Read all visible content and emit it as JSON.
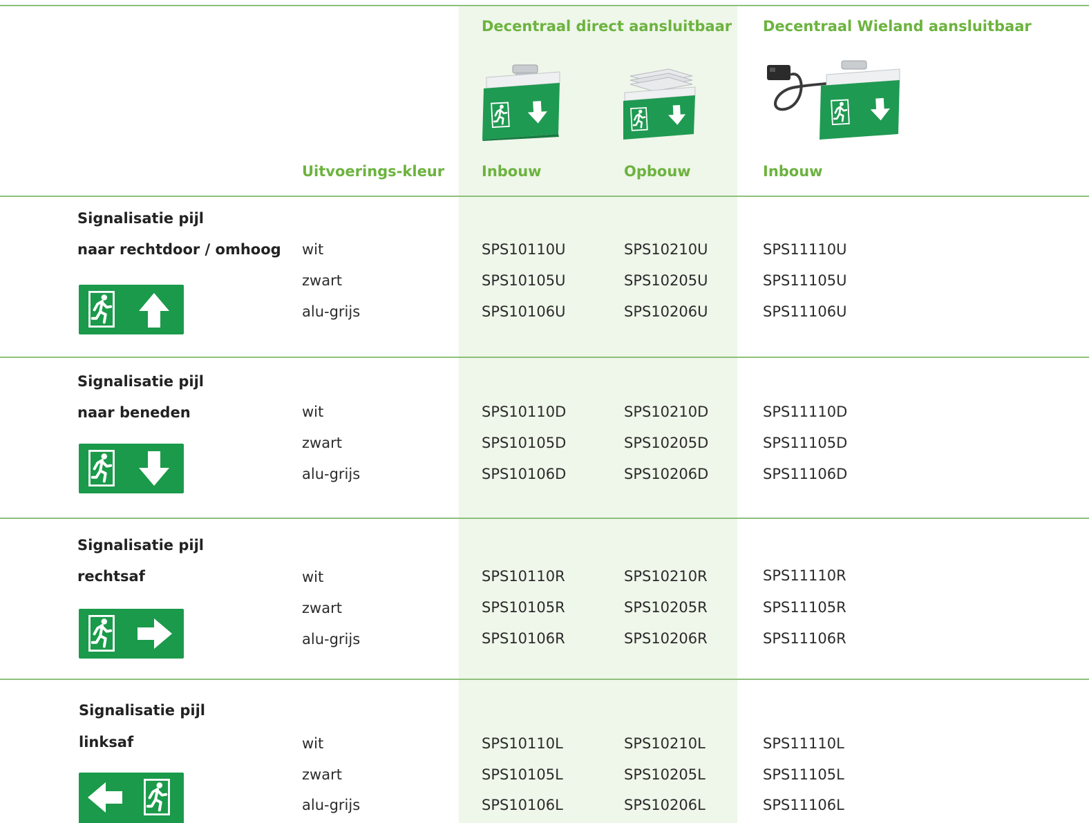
{
  "header": {
    "group_direct": "Decentraal direct aansluitbaar",
    "group_wieland": "Decentraal Wieland aansluitbaar",
    "col_color": "Uitvoerings-kleur",
    "col_inbouw": "Inbouw",
    "col_opbouw": "Opbouw",
    "col_wieland_inbouw": "Inbouw"
  },
  "colors": {
    "green": "#6cb33f",
    "sign_green": "#1a9a4a",
    "shade": "#eff6ea",
    "rule": "#8cc07a"
  },
  "sections": [
    {
      "title1": "Signalisatie pijl",
      "title2": "naar rechtdoor / omhoog",
      "arrow": "up",
      "rows": [
        {
          "color": "wit",
          "inbouw": "SPS10110U",
          "opbouw": "SPS10210U",
          "wieland": "SPS11110U"
        },
        {
          "color": "zwart",
          "inbouw": "SPS10105U",
          "opbouw": "SPS10205U",
          "wieland": "SPS11105U"
        },
        {
          "color": "alu-grijs",
          "inbouw": "SPS10106U",
          "opbouw": "SPS10206U",
          "wieland": "SPS11106U"
        }
      ]
    },
    {
      "title1": "Signalisatie pijl",
      "title2": "naar beneden",
      "arrow": "down",
      "rows": [
        {
          "color": "wit",
          "inbouw": "SPS10110D",
          "opbouw": "SPS10210D",
          "wieland": "SPS11110D"
        },
        {
          "color": "zwart",
          "inbouw": "SPS10105D",
          "opbouw": "SPS10205D",
          "wieland": "SPS11105D"
        },
        {
          "color": "alu-grijs",
          "inbouw": "SPS10106D",
          "opbouw": "SPS10206D",
          "wieland": "SPS11106D"
        }
      ]
    },
    {
      "title1": "Signalisatie pijl",
      "title2": "rechtsaf",
      "arrow": "right",
      "rows": [
        {
          "color": "wit",
          "inbouw": "SPS10110R",
          "opbouw": "SPS10210R",
          "wieland": "SPS11110R"
        },
        {
          "color": "zwart",
          "inbouw": "SPS10105R",
          "opbouw": "SPS10205R",
          "wieland": "SPS11105R"
        },
        {
          "color": "alu-grijs",
          "inbouw": "SPS10106R",
          "opbouw": "SPS10206R",
          "wieland": "SPS11106R"
        }
      ]
    },
    {
      "title1": "Signalisatie pijl",
      "title2": "linksaf",
      "arrow": "left",
      "rows": [
        {
          "color": "wit",
          "inbouw": "SPS10110L",
          "opbouw": "SPS10210L",
          "wieland": "SPS11110L"
        },
        {
          "color": "zwart",
          "inbouw": "SPS10105L",
          "opbouw": "SPS10205L",
          "wieland": "SPS11105L"
        },
        {
          "color": "alu-grijs",
          "inbouw": "SPS10106L",
          "opbouw": "SPS10206L",
          "wieland": "SPS11106L"
        }
      ]
    }
  ]
}
